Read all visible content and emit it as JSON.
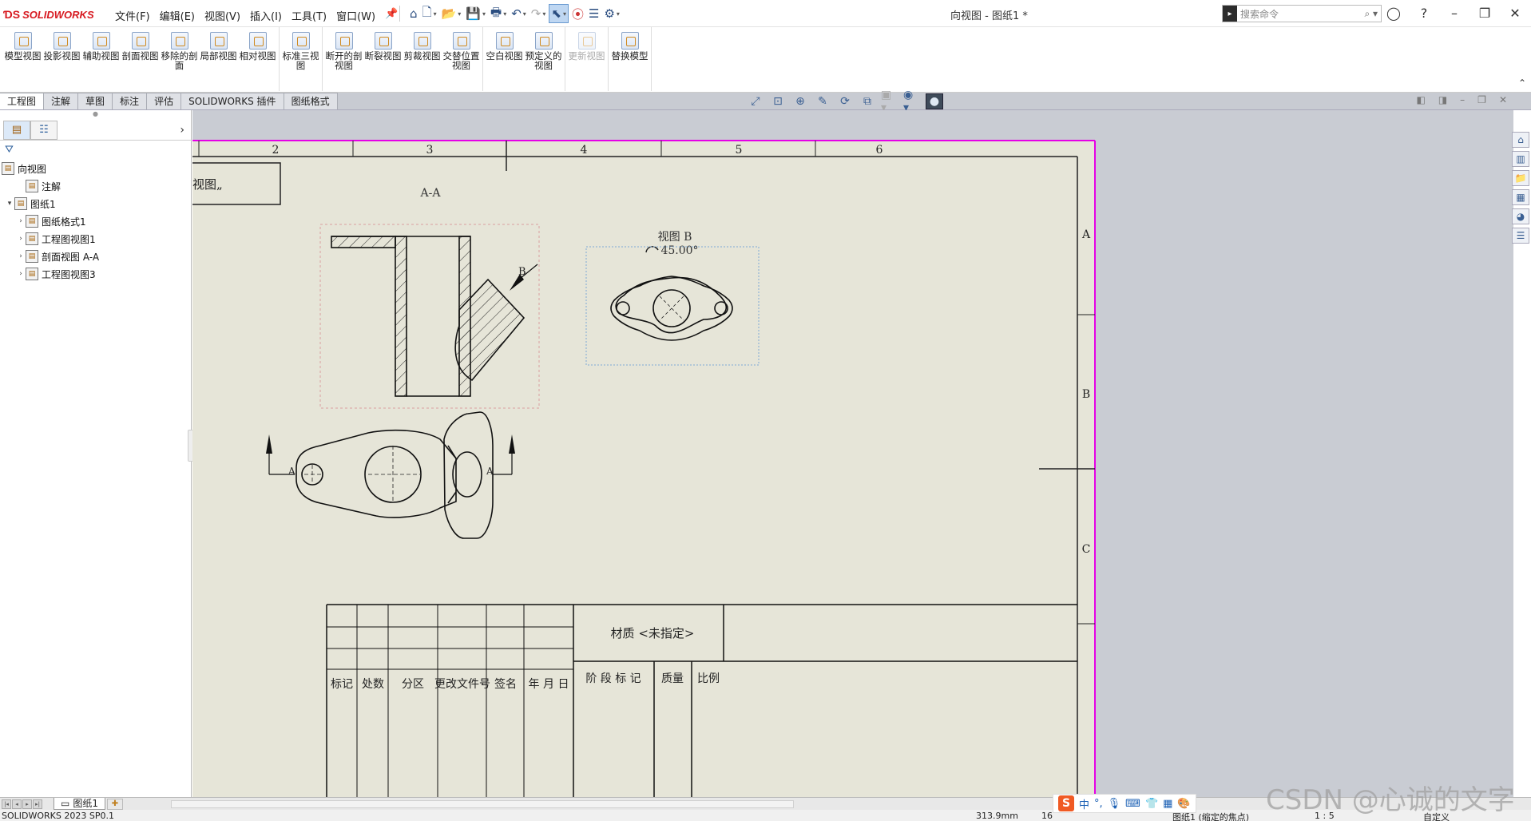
{
  "app": {
    "brand": "SOLIDWORKS",
    "document_title": "向视图 - 图纸1 *",
    "menu": [
      "文件(F)",
      "编辑(E)",
      "视图(V)",
      "插入(I)",
      "工具(T)",
      "窗口(W)"
    ],
    "search_placeholder": "搜索命令",
    "colors": {
      "brand": "#d71920",
      "sheet_border": "#e600e6",
      "sheet_bg": "#e6e5d8",
      "workspace": "#c9ccd3"
    }
  },
  "quick_toolbar": {
    "icons": [
      "home-icon",
      "new-icon",
      "open-icon",
      "save-icon",
      "print-icon",
      "undo-icon",
      "redo-icon",
      "select-icon",
      "traffic-light-icon",
      "file-props-icon",
      "options-icon"
    ]
  },
  "command_manager": {
    "groups": [
      [
        {
          "name": "model-view",
          "label": "模型视图"
        },
        {
          "name": "projected-view",
          "label": "投影视图"
        },
        {
          "name": "auxiliary-view",
          "label": "辅助视图"
        },
        {
          "name": "section-view",
          "label": "剖面视图"
        },
        {
          "name": "removed-section",
          "label": "移除的剖面"
        },
        {
          "name": "detail-view",
          "label": "局部视图"
        },
        {
          "name": "relative-view",
          "label": "相对视图"
        }
      ],
      [
        {
          "name": "standard-3-view",
          "label": "标准三视图"
        }
      ],
      [
        {
          "name": "broken-out-section",
          "label": "断开的剖视图"
        },
        {
          "name": "break-view",
          "label": "断裂视图"
        },
        {
          "name": "crop-view",
          "label": "剪裁视图"
        },
        {
          "name": "alternate-position",
          "label": "交替位置视图"
        }
      ],
      [
        {
          "name": "empty-view",
          "label": "空白视图"
        },
        {
          "name": "predefined-view",
          "label": "预定义的视图"
        }
      ],
      [
        {
          "name": "update-view",
          "label": "更新视图",
          "disabled": true
        }
      ],
      [
        {
          "name": "replace-model",
          "label": "替换模型"
        }
      ]
    ],
    "tabs": [
      "工程图",
      "注解",
      "草图",
      "标注",
      "评估",
      "SOLIDWORKS 插件",
      "图纸格式"
    ],
    "active_tab": "工程图"
  },
  "feature_tree": {
    "root": "向视图",
    "nodes": [
      {
        "label": "注解",
        "level": 1,
        "toggle": ""
      },
      {
        "label": "图纸1",
        "level": 0,
        "toggle": "▾"
      },
      {
        "label": "图纸格式1",
        "level": 1,
        "toggle": "›"
      },
      {
        "label": "工程图视图1",
        "level": 1,
        "toggle": "›"
      },
      {
        "label": "剖面视图 A-A",
        "level": 1,
        "toggle": "›"
      },
      {
        "label": "工程图视图3",
        "level": 1,
        "toggle": "›"
      }
    ]
  },
  "drawing": {
    "zone_numbers": [
      "2",
      "3",
      "4",
      "5",
      "6"
    ],
    "zone_letters": [
      "A",
      "B",
      "C"
    ],
    "partial_title": "视图„",
    "section_label": "A-A",
    "view_b_label": "视图 B",
    "rotation": "45.00°",
    "arrow_label_b": "B",
    "arrow_label_a": "A",
    "title_block": {
      "material": "材质 <未指定>",
      "header_cells": [
        "标记",
        "处数",
        "分区",
        "更改文件号",
        "签名",
        "年 月 日"
      ],
      "stage": "阶 段 标 记",
      "mass": "质量",
      "scale": "比例"
    }
  },
  "sheet_tab": "图纸1",
  "status": {
    "version": "SOLIDWORKS 2023 SP0.1",
    "x": "313.9mm",
    "y": "16",
    "sheet_info": "图纸1 (缩定的焦点)",
    "scale": "1 : 5",
    "units": "自定义"
  },
  "watermark": "CSDN @心诚的文字"
}
